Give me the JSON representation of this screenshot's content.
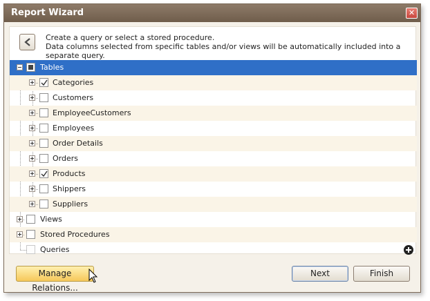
{
  "window": {
    "title": "Report Wizard",
    "close_symbol": "✕"
  },
  "description": {
    "line1": "Create a query or select a stored procedure.",
    "line2": "Data columns selected from specific tables and/or views will be automatically included into a separate query."
  },
  "tree": {
    "root_tables": {
      "label": "Tables",
      "state": "indeterminate",
      "expanded": true,
      "selected": true
    },
    "tables": [
      {
        "label": "Categories",
        "checked": true
      },
      {
        "label": "Customers",
        "checked": false
      },
      {
        "label": "EmployeeCustomers",
        "checked": false
      },
      {
        "label": "Employees",
        "checked": false
      },
      {
        "label": "Order Details",
        "checked": false
      },
      {
        "label": "Orders",
        "checked": false
      },
      {
        "label": "Products",
        "checked": true
      },
      {
        "label": "Shippers",
        "checked": false
      },
      {
        "label": "Suppliers",
        "checked": false
      }
    ],
    "views": {
      "label": "Views",
      "checked": false
    },
    "stored_procedures": {
      "label": "Stored Procedures",
      "checked": false
    },
    "queries": {
      "label": "Queries",
      "checked": false,
      "add_icon": "plus-circle-icon"
    }
  },
  "buttons": {
    "manage_relations": "Manage Relations...",
    "next": "Next",
    "finish": "Finish"
  },
  "colors": {
    "selection": "#2f6fc7",
    "alt_row": "#faf4e7",
    "titlebar": "#7f6c5a",
    "accent_button": "#f6c85a"
  }
}
